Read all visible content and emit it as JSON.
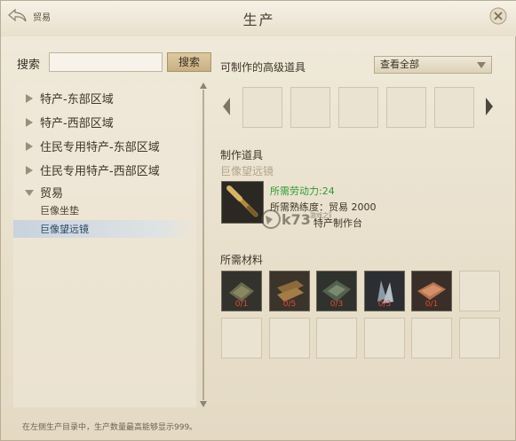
{
  "header": {
    "back_label": "贸易",
    "title": "生产"
  },
  "search": {
    "label": "搜索",
    "value": "",
    "placeholder": "",
    "button_label": "搜索"
  },
  "tree": {
    "items": [
      {
        "label": "特产-东部区域",
        "expanded": false
      },
      {
        "label": "特产-西部区域",
        "expanded": false
      },
      {
        "label": "住民专用特产-东部区域",
        "expanded": false
      },
      {
        "label": "住民专用特产-西部区域",
        "expanded": false
      },
      {
        "label": "贸易",
        "expanded": true
      }
    ],
    "children": [
      {
        "label": "巨像坐垫",
        "selected": false
      },
      {
        "label": "巨像望远镜",
        "selected": true
      }
    ]
  },
  "footer_note": "在左侧生产目录中，生产数量最高能够显示999。",
  "advanced": {
    "label": "可制作的高级道具",
    "dropdown_value": "查看全部"
  },
  "craft": {
    "section_label": "制作道具",
    "item_name": "巨像望远镜",
    "labor_line": "所需劳动力:24",
    "skill_line": "所需熟练度：贸易 2000",
    "station_line": "特产制作台",
    "labor_color": "#2e9a2e"
  },
  "materials": {
    "label": "所需材料",
    "items": [
      {
        "icon": "plank-bundle-icon",
        "count": "0/1"
      },
      {
        "icon": "lumber-icon",
        "count": "0/5"
      },
      {
        "icon": "ore-block-icon",
        "count": "0/3"
      },
      {
        "icon": "crystal-icon",
        "count": "0/3"
      },
      {
        "icon": "copper-ingot-icon",
        "count": "0/1"
      }
    ]
  },
  "watermark": {
    "text_top": "k73",
    "text_sub": "游戏之家"
  }
}
